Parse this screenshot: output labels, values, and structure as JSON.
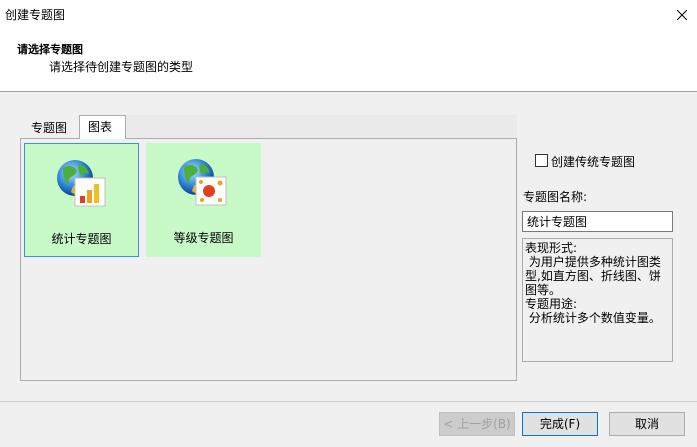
{
  "window": {
    "title": "创建专题图"
  },
  "header": {
    "title": "请选择专题图",
    "subtitle": "请选择待创建专题图的类型"
  },
  "tabs": [
    {
      "label": "专题图",
      "active": false
    },
    {
      "label": "图表",
      "active": true
    }
  ],
  "cards": [
    {
      "label": "统计专题图",
      "icon": "globe-bar-chart-icon",
      "selected": true
    },
    {
      "label": "等级专题图",
      "icon": "globe-graduated-symbol-icon",
      "selected": false
    }
  ],
  "options": {
    "traditional_label": "创建传统专题图",
    "traditional_checked": false
  },
  "name_field": {
    "label": "专题图名称:",
    "value": "统计专题图"
  },
  "description": {
    "lines": [
      "表现形式:",
      " 为用户提供多种统计图类",
      "型,如直方图、折线图、饼",
      "图等。",
      "专题用途:",
      " 分析统计多个数值变量。"
    ]
  },
  "buttons": {
    "prev": "< 上一步(B)",
    "finish": "完成(F)",
    "cancel": "取消"
  },
  "colors": {
    "card_bg": "#c8fac8",
    "selection_border": "#3b8fe6",
    "accent": "#0078d7"
  }
}
